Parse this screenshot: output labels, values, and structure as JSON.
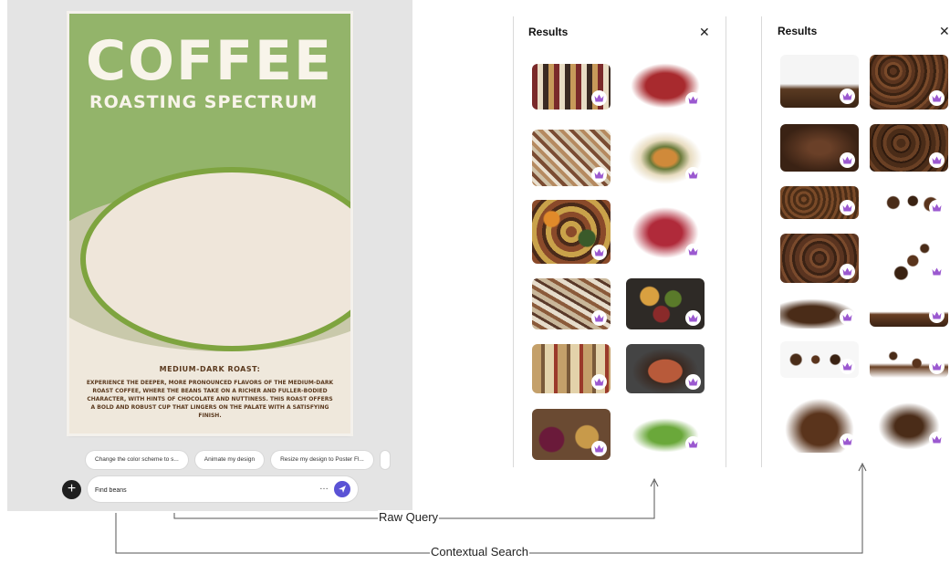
{
  "poster": {
    "title": "COFFEE",
    "subtitle": "ROASTING SPECTRUM",
    "roast_heading": "MEDIUM-DARK ROAST:",
    "body_text": "EXPERIENCE THE DEEPER, MORE PRONOUNCED FLAVORS OF THE MEDIUM-DARK ROAST COFFEE, WHERE THE BEANS TAKE ON A RICHER AND FULLER-BODIED CHARACTER, WITH HINTS OF CHOCOLATE AND NUTTINESS. THIS ROAST OFFERS A BOLD AND ROBUST CUP THAT LINGERS ON THE PALATE WITH A SATISFYING FINISH.",
    "colors": {
      "green": "#93b46a",
      "paper": "#efe8dc",
      "text": "#5b3a1f"
    }
  },
  "suggestions": [
    "Change the color scheme to s...",
    "Animate my design",
    "Resize my design to Poster Fl..."
  ],
  "prompt": {
    "value": "Find beans",
    "more": "…",
    "send_icon": "send-icon",
    "add_icon": "plus-icon"
  },
  "panels": {
    "raw": {
      "title": "Results",
      "close": "✕"
    },
    "contextual": {
      "title": "Results",
      "close": "✕"
    }
  },
  "annotations": {
    "raw_query": "Raw Query",
    "contextual_search": "Contextual Search"
  },
  "colors": {
    "accent": "#5a52d5",
    "premium_crown": "#9b59d0"
  }
}
